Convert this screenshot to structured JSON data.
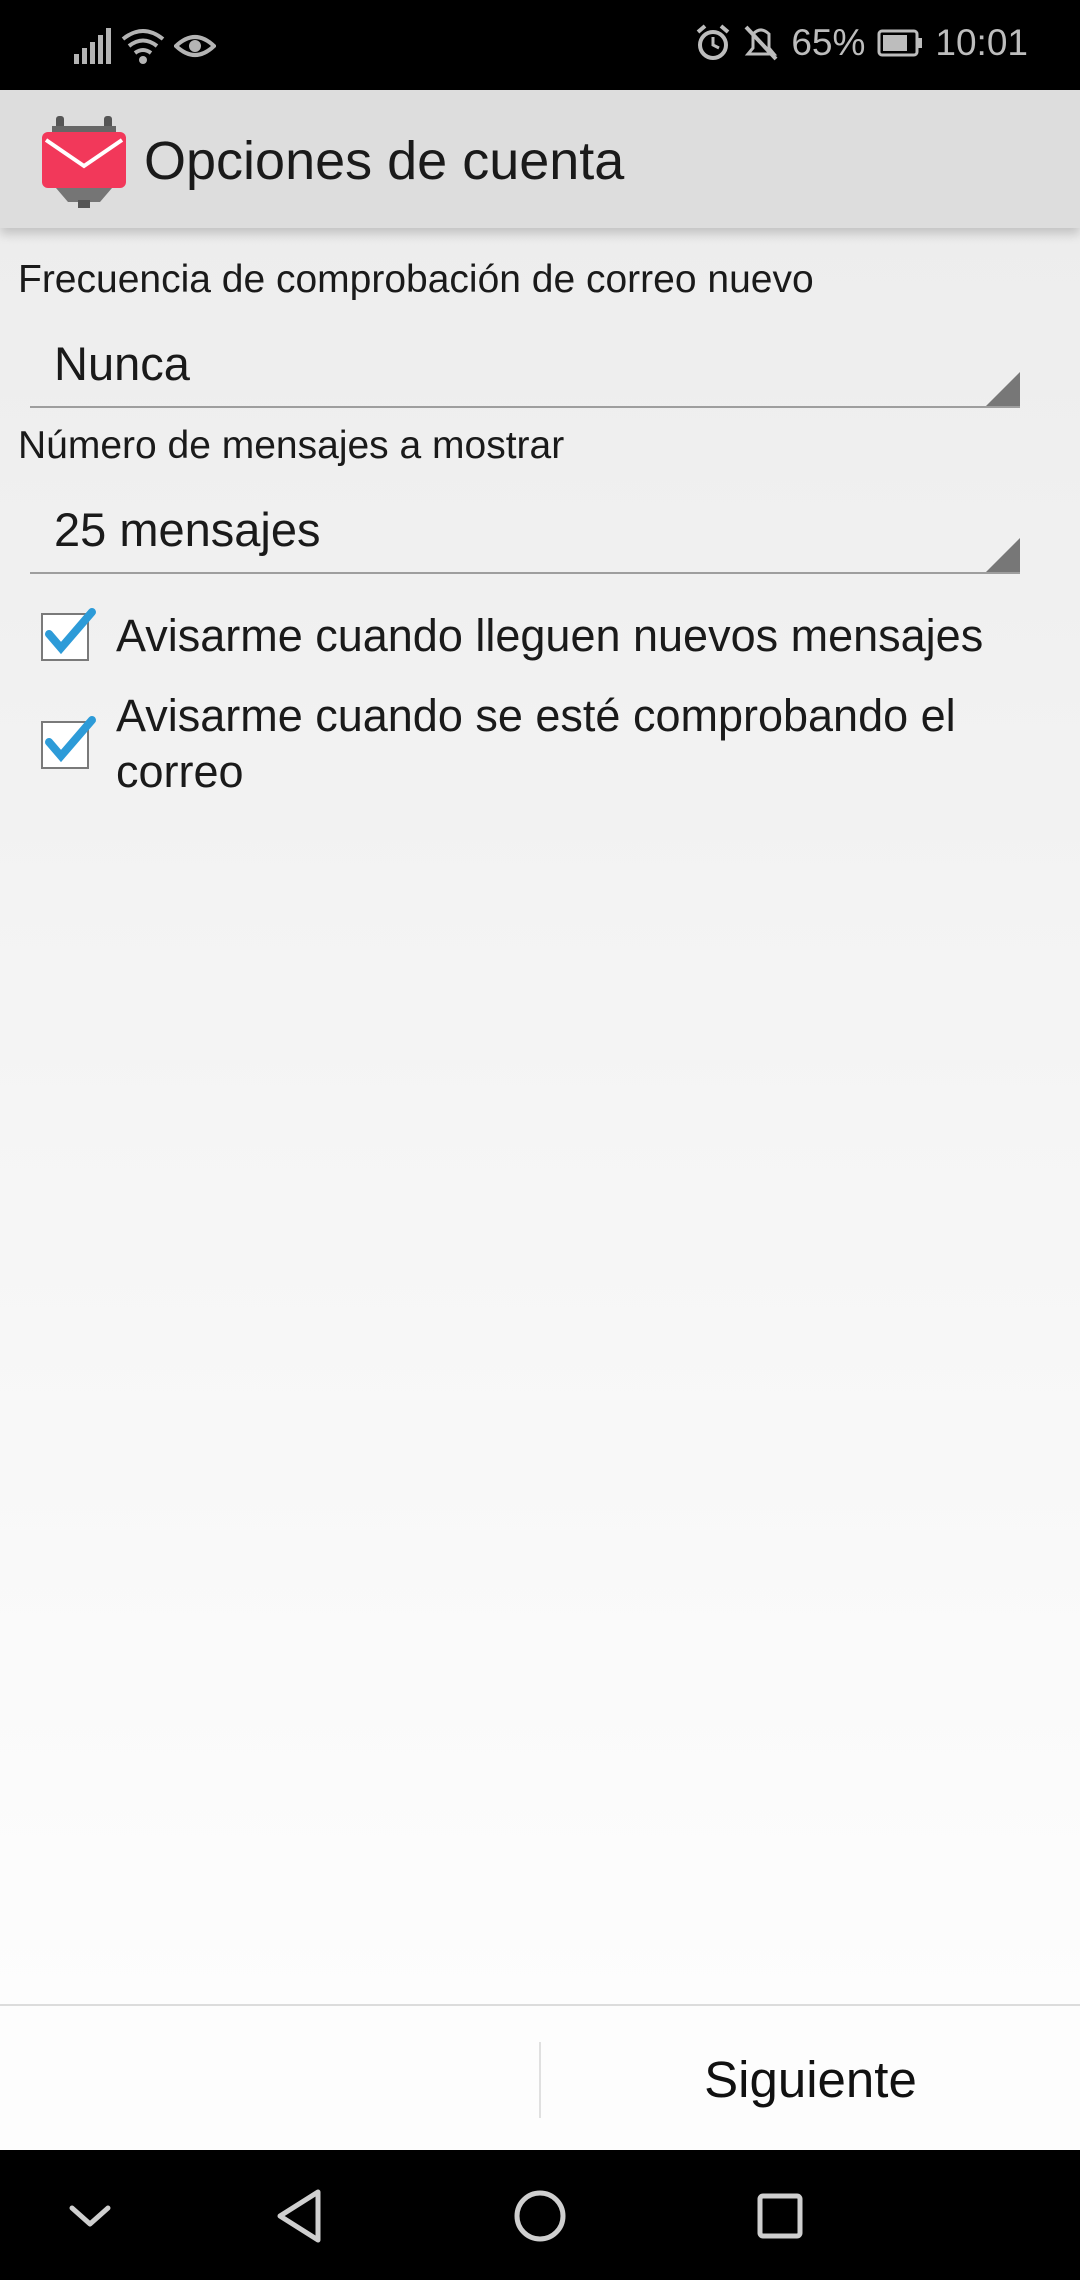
{
  "status_bar": {
    "battery_percent": "65%",
    "time": "10:01",
    "icons": [
      "signal-icon",
      "wifi-icon",
      "eye-icon",
      "alarm-icon",
      "mute-icon",
      "battery-icon"
    ]
  },
  "action_bar": {
    "title": "Opciones de cuenta",
    "app_icon": "k9-mail-app-icon"
  },
  "settings": {
    "frequency_label": "Frecuencia de comprobación de correo nuevo",
    "frequency_value": "Nunca",
    "display_count_label": "Número de mensajes a mostrar",
    "display_count_value": "25 mensajes",
    "checkboxes": [
      {
        "label": "Avisarme cuando lleguen nuevos mensajes",
        "checked": true
      },
      {
        "label": "Avisarme cuando se esté comprobando el correo",
        "checked": true
      }
    ]
  },
  "buttons": {
    "next_label": "Siguiente"
  },
  "nav_bar": {
    "icons": [
      "chevron-down-icon",
      "back-icon",
      "home-icon",
      "recents-icon"
    ]
  },
  "colors": {
    "check_blue": "#2d9bd8",
    "app_icon_red": "#f2385a"
  }
}
